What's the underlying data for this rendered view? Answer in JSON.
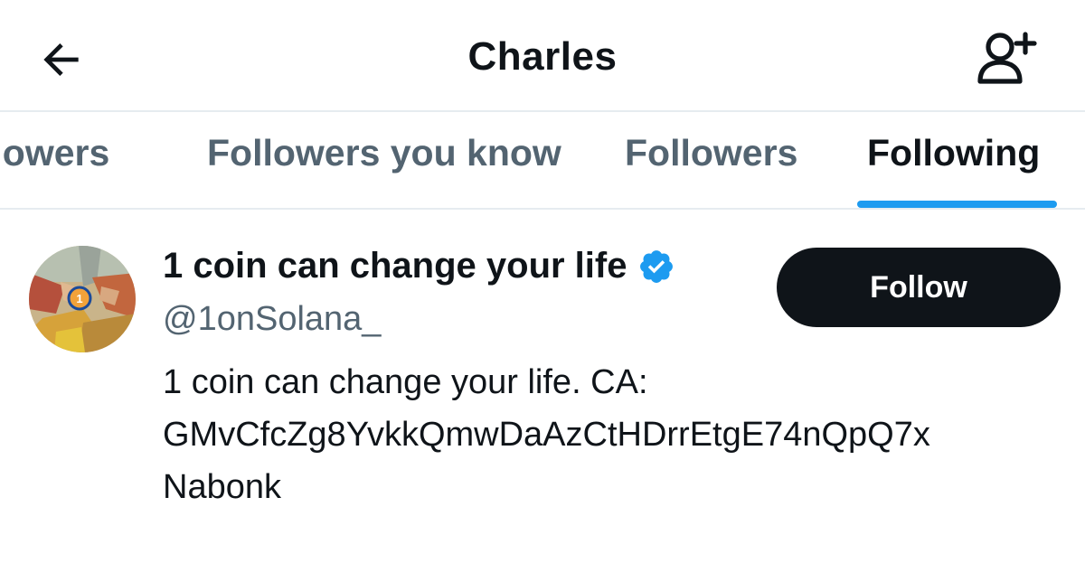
{
  "header": {
    "title": "Charles",
    "back_icon": "arrow-left-icon",
    "add_user_icon": "person-plus-icon"
  },
  "tabs": [
    {
      "label": "Verified Followers",
      "visible_label": "llowers",
      "active": false
    },
    {
      "label": "Followers you know",
      "active": false
    },
    {
      "label": "Followers",
      "active": false
    },
    {
      "label": "Following",
      "active": true
    }
  ],
  "user": {
    "display_name": "1 coin can change your life",
    "verified": true,
    "verified_color": "#1d9bf0",
    "handle": "@1onSolana_",
    "follow_label": "Follow",
    "bio_lines": [
      "1 coin can change your life. CA:",
      "GMvCfcZg8YvkkQmwDaAzCtHDrrEtgE74nQpQ7x",
      "Nabonk"
    ],
    "avatar_badge": "1"
  },
  "colors": {
    "accent": "#1d9bf0",
    "text_primary": "#0f1419",
    "text_secondary": "#536471",
    "divider": "#e6ecf0"
  }
}
